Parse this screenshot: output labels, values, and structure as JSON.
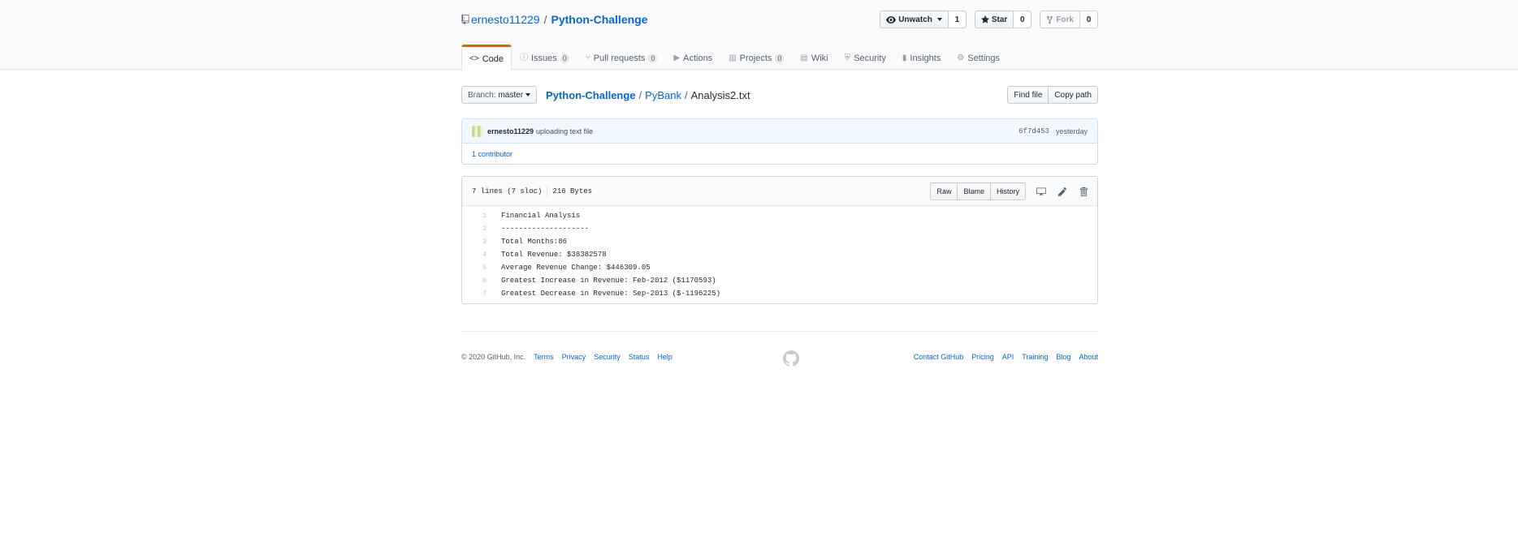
{
  "repo": {
    "owner": "ernesto11229",
    "separator": "/",
    "name": "Python-Challenge"
  },
  "actions": {
    "watch_label": "Unwatch",
    "watch_count": "1",
    "star_label": "Star",
    "star_count": "0",
    "fork_label": "Fork",
    "fork_count": "0"
  },
  "nav": {
    "code": "Code",
    "issues": "Issues",
    "issues_count": "0",
    "pulls": "Pull requests",
    "pulls_count": "0",
    "actions": "Actions",
    "projects": "Projects",
    "projects_count": "0",
    "wiki": "Wiki",
    "security": "Security",
    "insights": "Insights",
    "settings": "Settings"
  },
  "file_nav": {
    "branch_prefix": "Branch:",
    "branch": "master",
    "crumbs": [
      "Python-Challenge",
      "PyBank",
      "Analysis2.txt"
    ],
    "sep": "/",
    "find_file": "Find file",
    "copy_path": "Copy path"
  },
  "commit": {
    "author": "ernesto11229",
    "message": "uploading text file",
    "sha": "6f7d453",
    "time": "yesterday",
    "contributors": "1 contributor"
  },
  "file": {
    "lines_info": "7 lines (7 sloc)",
    "size": "216 Bytes",
    "raw": "Raw",
    "blame": "Blame",
    "history": "History",
    "lines": [
      {
        "num": "1",
        "text": "Financial Analysis"
      },
      {
        "num": "2",
        "text": "--------------------"
      },
      {
        "num": "3",
        "text": "Total Months:86"
      },
      {
        "num": "4",
        "text": "Total Revenue: $38382578"
      },
      {
        "num": "5",
        "text": "Average Revenue Change: $446309.05"
      },
      {
        "num": "6",
        "text": "Greatest Increase in Revenue: Feb-2012 ($1170593)"
      },
      {
        "num": "7",
        "text": "Greatest Decrease in Revenue: Sep-2013 ($-1196225)"
      }
    ]
  },
  "footer": {
    "copyright": "© 2020 GitHub, Inc.",
    "left_links": [
      "Terms",
      "Privacy",
      "Security",
      "Status",
      "Help"
    ],
    "right_links": [
      "Contact GitHub",
      "Pricing",
      "API",
      "Training",
      "Blog",
      "About"
    ]
  },
  "colors": {
    "link": "#0366d6",
    "tab_accent": "#e36209",
    "commit_bg": "#f1f8ff"
  },
  "icons": [
    "repo-icon",
    "eye-icon",
    "star-icon",
    "repo-forked-icon",
    "code-icon",
    "issue-icon",
    "pull-request-icon",
    "play-icon",
    "project-icon",
    "book-icon",
    "shield-icon",
    "graph-icon",
    "gear-icon",
    "device-desktop-icon",
    "pencil-icon",
    "trash-icon",
    "github-mark-icon"
  ]
}
